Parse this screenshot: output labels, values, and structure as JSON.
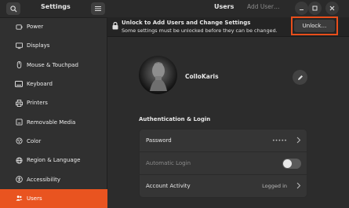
{
  "sidebar": {
    "title": "Settings",
    "items": [
      {
        "label": "Power",
        "icon": "power-icon"
      },
      {
        "label": "Displays",
        "icon": "display-icon"
      },
      {
        "label": "Mouse & Touchpad",
        "icon": "mouse-icon"
      },
      {
        "label": "Keyboard",
        "icon": "keyboard-icon"
      },
      {
        "label": "Printers",
        "icon": "printer-icon"
      },
      {
        "label": "Removable Media",
        "icon": "removable-media-icon"
      },
      {
        "label": "Color",
        "icon": "color-icon"
      },
      {
        "label": "Region & Language",
        "icon": "region-icon"
      },
      {
        "label": "Accessibility",
        "icon": "accessibility-icon"
      },
      {
        "label": "Users",
        "icon": "users-icon",
        "active": true
      }
    ]
  },
  "header": {
    "title": "Users",
    "add_user_label": "Add User…"
  },
  "unlock": {
    "title": "Unlock to Add Users and Change Settings",
    "subtitle": "Some settings must be unlocked before they can be changed.",
    "button_label": "Unlock…"
  },
  "user": {
    "name": "ColloKaris"
  },
  "auth": {
    "section_title": "Authentication & Login",
    "rows": [
      {
        "label": "Password",
        "value": "•••••"
      },
      {
        "label": "Automatic Login",
        "value": ""
      },
      {
        "label": "Account Activity",
        "value": "Logged in"
      }
    ]
  },
  "colors": {
    "accent": "#e95420",
    "highlight_border": "#e84e1b"
  }
}
